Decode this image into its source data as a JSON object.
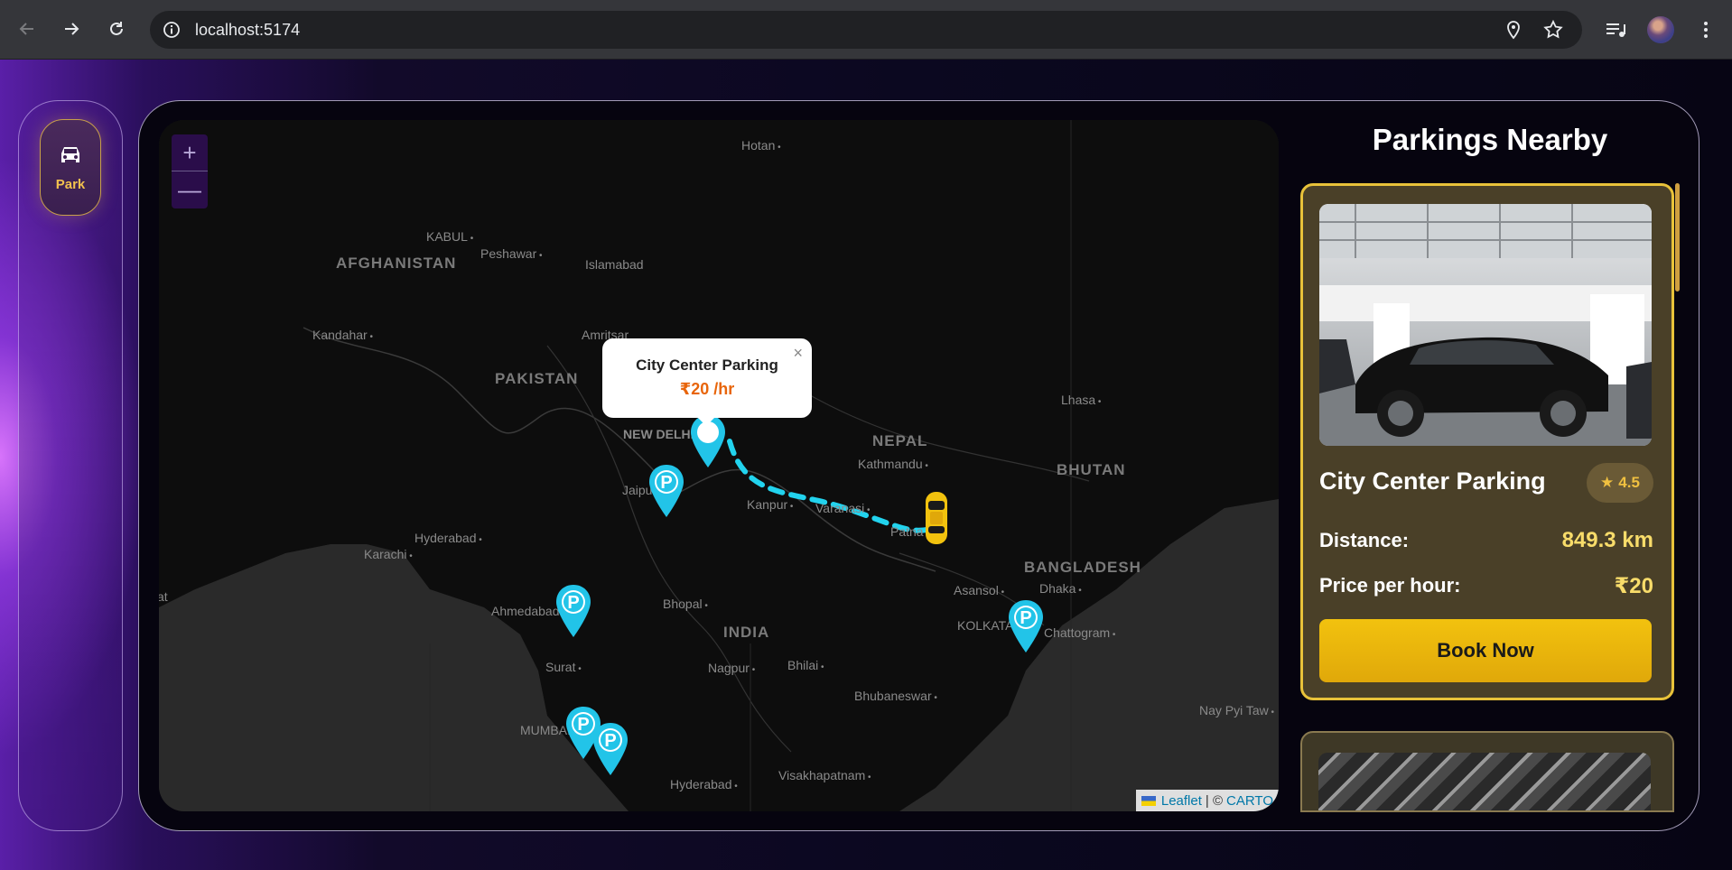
{
  "browser": {
    "url": "localhost:5174",
    "icons": [
      "back-icon",
      "forward-icon",
      "reload-icon",
      "info-icon",
      "location-icon",
      "star-icon",
      "media-icon",
      "avatar",
      "menu-icon"
    ]
  },
  "sidebar": {
    "items": [
      {
        "label": "Park",
        "icon": "car-icon"
      }
    ]
  },
  "map": {
    "zoom_in": "+",
    "zoom_out": "—",
    "labels": {
      "hotan": "Hotan",
      "kabul": "KABUL",
      "afghanistan": "AFGHANISTAN",
      "peshawar": "Peshawar",
      "islamabad": "Islamabad",
      "kandahar": "Kandahar",
      "amritsar": "Amritsar",
      "pakistan": "PAKISTAN",
      "new_delhi": "NEW DELHI",
      "jaipur": "Jaipur",
      "nepal": "NEPAL",
      "kathmandu": "Kathmandu",
      "lhasa": "Lhasa",
      "bhutan": "BHUTAN",
      "kanpur": "Kanpur",
      "varanasi": "Varanasi",
      "patna": "Patna",
      "hyderabad_pk": "Hyderabad",
      "karachi": "Karachi",
      "bangladesh": "BANGLADESH",
      "dhaka": "Dhaka",
      "asansol": "Asansol",
      "ahmedabad": "Ahmedabad",
      "bhopal": "Bhopal",
      "india": "INDIA",
      "kolkata": "KOLKATA",
      "chattogram": "Chattogram",
      "surat": "Surat",
      "nagpur": "Nagpur",
      "bhilai": "Bhilai",
      "bhubaneswar": "Bhubaneswar",
      "mumbai": "MUMBAI",
      "nay_pyi_taw": "Nay Pyi Taw",
      "hyderabad_in": "Hyderabad",
      "visakhapatnam": "Visakhapatnam",
      "edge_label": "at"
    },
    "popup": {
      "title": "City Center Parking",
      "price": "₹20 /hr",
      "close": "×"
    },
    "attribution": {
      "leaflet": "Leaflet",
      "separator": "| ©",
      "carto": "CARTO"
    },
    "route_color": "#22d3ee",
    "pin_color": "#22c4e8"
  },
  "panel": {
    "title": "Parkings Nearby",
    "cards": [
      {
        "name": "City Center Parking",
        "rating": "4.5",
        "distance_label": "Distance:",
        "distance": "849.3 km",
        "price_label": "Price per hour:",
        "price": "₹20",
        "button": "Book Now"
      }
    ]
  },
  "colors": {
    "accent_gold": "#e8c23a",
    "card_bg": "#4a4028",
    "button_gold": "#f2c20e"
  }
}
